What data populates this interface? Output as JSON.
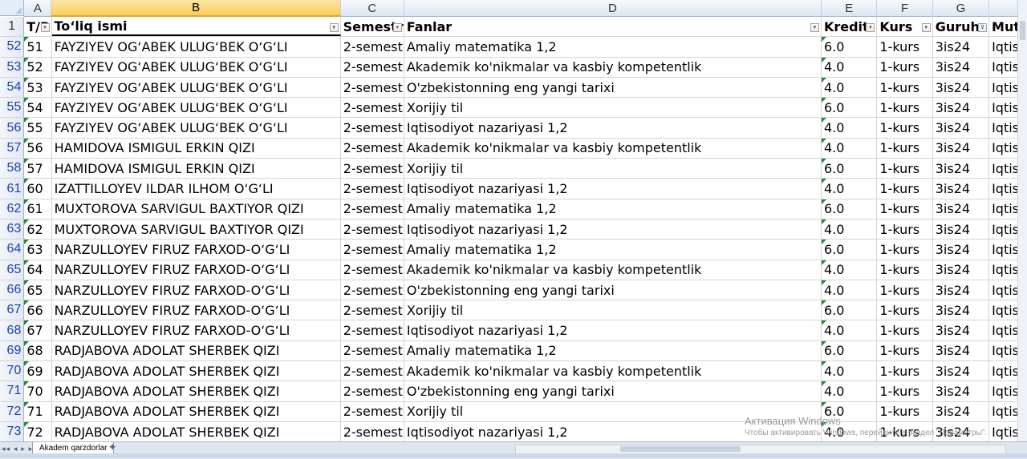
{
  "columns": [
    "A",
    "B",
    "C",
    "D",
    "E",
    "F",
    "G"
  ],
  "header_row": {
    "row_num": "1",
    "cells": [
      "T/P",
      "To‘liq ismi",
      "Semestr",
      "Fanlar",
      "Kredit",
      "Kurs",
      "Guruh",
      "Muta"
    ]
  },
  "rows": [
    {
      "n": "52",
      "a": "51",
      "b": "FAYZIYEV OG‘ABEK ULUG‘BEK O‘G‘LI",
      "c": "2-semestr",
      "d": "Amaliy matematika 1,2",
      "e": "6.0",
      "f": "1-kurs",
      "g": "3is24",
      "h": "Iqtiso"
    },
    {
      "n": "53",
      "a": "52",
      "b": "FAYZIYEV OG‘ABEK ULUG‘BEK O‘G‘LI",
      "c": "2-semestr",
      "d": "Akademik ko'nikmalar va kasbiy kompetentlik",
      "e": "4.0",
      "f": "1-kurs",
      "g": "3is24",
      "h": "Iqtiso"
    },
    {
      "n": "54",
      "a": "53",
      "b": "FAYZIYEV OG‘ABEK ULUG‘BEK O‘G‘LI",
      "c": "2-semestr",
      "d": "O'zbekistonning eng yangi tarixi",
      "e": "4.0",
      "f": "1-kurs",
      "g": "3is24",
      "h": "Iqtiso"
    },
    {
      "n": "55",
      "a": "54",
      "b": "FAYZIYEV OG‘ABEK ULUG‘BEK O‘G‘LI",
      "c": "2-semestr",
      "d": "Xorijiy til",
      "e": "6.0",
      "f": "1-kurs",
      "g": "3is24",
      "h": "Iqtiso"
    },
    {
      "n": "56",
      "a": "55",
      "b": "FAYZIYEV OG‘ABEK ULUG‘BEK O‘G‘LI",
      "c": "2-semestr",
      "d": "Iqtisodiyot nazariyasi 1,2",
      "e": "4.0",
      "f": "1-kurs",
      "g": "3is24",
      "h": "Iqtiso"
    },
    {
      "n": "57",
      "a": "56",
      "b": "HAMIDOVA ISMIGUL ERKIN QIZI",
      "c": "2-semestr",
      "d": "Akademik ko'nikmalar va kasbiy kompetentlik",
      "e": "4.0",
      "f": "1-kurs",
      "g": "3is24",
      "h": "Iqtiso"
    },
    {
      "n": "58",
      "a": "57",
      "b": "HAMIDOVA ISMIGUL ERKIN QIZI",
      "c": "2-semestr",
      "d": "Xorijiy til",
      "e": "6.0",
      "f": "1-kurs",
      "g": "3is24",
      "h": "Iqtiso"
    },
    {
      "n": "61",
      "a": "60",
      "b": "IZATTILLOYEV ILDAR ILHOM O‘G‘LI",
      "c": "2-semestr",
      "d": "Iqtisodiyot nazariyasi 1,2",
      "e": "4.0",
      "f": "1-kurs",
      "g": "3is24",
      "h": "Iqtiso"
    },
    {
      "n": "62",
      "a": "61",
      "b": "MUXTOROVA SARVIGUL BAXTIYOR QIZI",
      "c": "2-semestr",
      "d": "Amaliy matematika 1,2",
      "e": "6.0",
      "f": "1-kurs",
      "g": "3is24",
      "h": "Iqtiso"
    },
    {
      "n": "63",
      "a": "62",
      "b": "MUXTOROVA SARVIGUL BAXTIYOR QIZI",
      "c": "2-semestr",
      "d": "Iqtisodiyot nazariyasi 1,2",
      "e": "4.0",
      "f": "1-kurs",
      "g": "3is24",
      "h": "Iqtiso"
    },
    {
      "n": "64",
      "a": "63",
      "b": "NARZULLOYEV FIRUZ FARXOD-O‘G‘LI",
      "c": "2-semestr",
      "d": "Amaliy matematika 1,2",
      "e": "6.0",
      "f": "1-kurs",
      "g": "3is24",
      "h": "Iqtiso"
    },
    {
      "n": "65",
      "a": "64",
      "b": "NARZULLOYEV FIRUZ FARXOD-O‘G‘LI",
      "c": "2-semestr",
      "d": "Akademik ko'nikmalar va kasbiy kompetentlik",
      "e": "4.0",
      "f": "1-kurs",
      "g": "3is24",
      "h": "Iqtiso"
    },
    {
      "n": "66",
      "a": "65",
      "b": "NARZULLOYEV FIRUZ FARXOD-O‘G‘LI",
      "c": "2-semestr",
      "d": "O'zbekistonning eng yangi tarixi",
      "e": "4.0",
      "f": "1-kurs",
      "g": "3is24",
      "h": "Iqtiso"
    },
    {
      "n": "67",
      "a": "66",
      "b": "NARZULLOYEV FIRUZ FARXOD-O‘G‘LI",
      "c": "2-semestr",
      "d": "Xorijiy til",
      "e": "6.0",
      "f": "1-kurs",
      "g": "3is24",
      "h": "Iqtiso"
    },
    {
      "n": "68",
      "a": "67",
      "b": "NARZULLOYEV FIRUZ FARXOD-O‘G‘LI",
      "c": "2-semestr",
      "d": "Iqtisodiyot nazariyasi 1,2",
      "e": "4.0",
      "f": "1-kurs",
      "g": "3is24",
      "h": "Iqtiso"
    },
    {
      "n": "69",
      "a": "68",
      "b": "RADJABOVA ADOLAT SHERBEK QIZI",
      "c": "2-semestr",
      "d": "Amaliy matematika 1,2",
      "e": "6.0",
      "f": "1-kurs",
      "g": "3is24",
      "h": "Iqtiso"
    },
    {
      "n": "70",
      "a": "69",
      "b": "RADJABOVA ADOLAT SHERBEK QIZI",
      "c": "2-semestr",
      "d": "Akademik ko'nikmalar va kasbiy kompetentlik",
      "e": "4.0",
      "f": "1-kurs",
      "g": "3is24",
      "h": "Iqtiso"
    },
    {
      "n": "71",
      "a": "70",
      "b": "RADJABOVA ADOLAT SHERBEK QIZI",
      "c": "2-semestr",
      "d": "O'zbekistonning eng yangi tarixi",
      "e": "4.0",
      "f": "1-kurs",
      "g": "3is24",
      "h": "Iqtiso"
    },
    {
      "n": "72",
      "a": "71",
      "b": "RADJABOVA ADOLAT SHERBEK QIZI",
      "c": "2-semestr",
      "d": "Xorijiy til",
      "e": "6.0",
      "f": "1-kurs",
      "g": "3is24",
      "h": "Iqtiso"
    },
    {
      "n": "73",
      "a": "72",
      "b": "RADJABOVA ADOLAT SHERBEK QIZI",
      "c": "2-semestr",
      "d": "Iqtisodiyot nazariyasi 1,2",
      "e": "4.0",
      "f": "1-kurs",
      "g": "3is24",
      "h": "Iqtiso"
    }
  ],
  "sheet_tab": "Akadem qarzdorlar",
  "watermark": {
    "line1": "Активация Windows",
    "line2": "Чтобы активировать Windows, перейдите в раздел \"Параметры\"."
  },
  "icons": {
    "filter": "filter-dropdown-icon",
    "filter_active": "filter-active-icon",
    "new_sheet": "new-sheet-icon",
    "nav": "sheet-nav-icon"
  },
  "colors": {
    "selected_column": "#f7cd5c",
    "row_number_text": "#1a3fb0",
    "error_triangle": "#1e8b3a"
  }
}
